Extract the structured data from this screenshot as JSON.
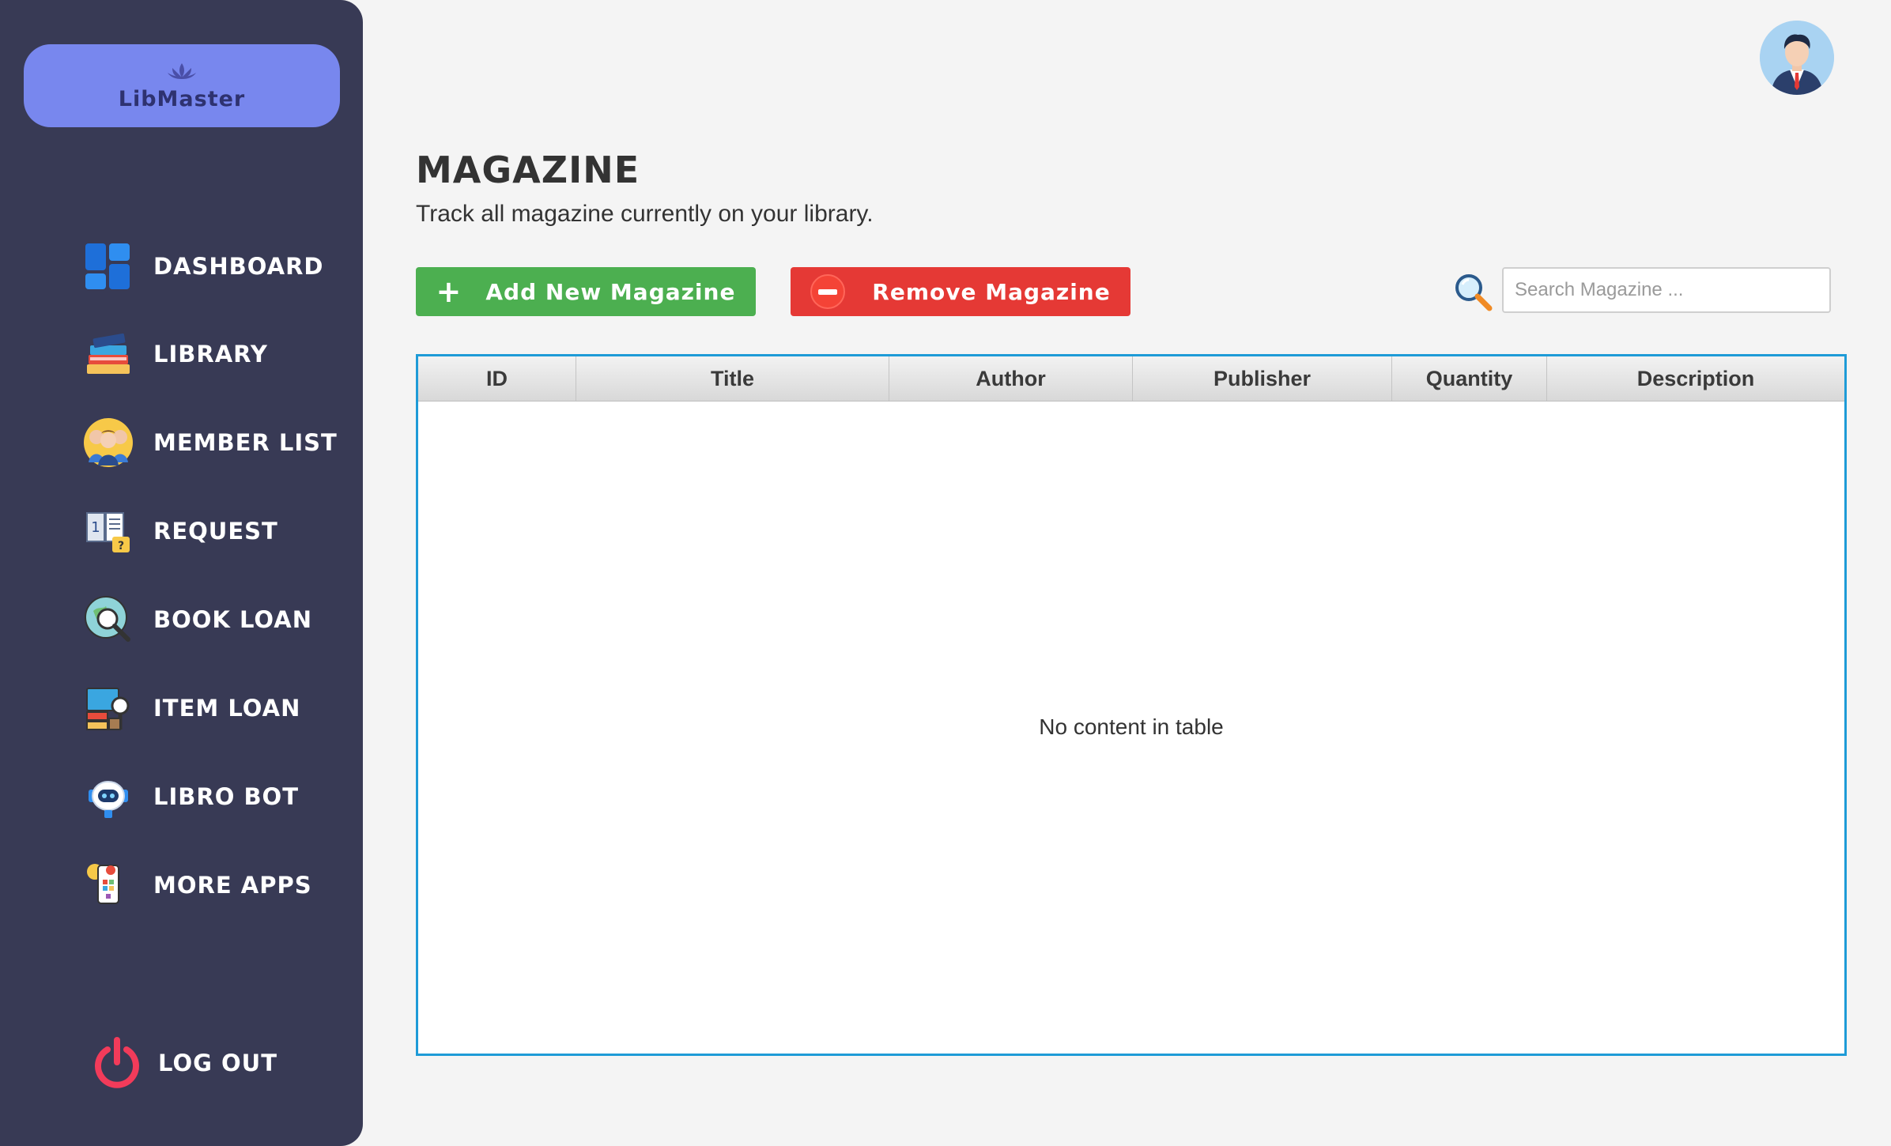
{
  "app": {
    "name": "LibMaster"
  },
  "sidebar": {
    "items": [
      {
        "label": "DASHBOARD",
        "icon": "dashboard-icon"
      },
      {
        "label": "LIBRARY",
        "icon": "books-icon"
      },
      {
        "label": "MEMBER LIST",
        "icon": "members-icon"
      },
      {
        "label": "REQUEST",
        "icon": "request-icon"
      },
      {
        "label": "BOOK LOAN",
        "icon": "book-loan-icon"
      },
      {
        "label": "ITEM LOAN",
        "icon": "item-loan-icon"
      },
      {
        "label": "LIBRO BOT",
        "icon": "robot-icon"
      },
      {
        "label": "MORE APPS",
        "icon": "apps-icon"
      }
    ],
    "logout_label": "LOG OUT"
  },
  "header": {
    "title": "MAGAZINE",
    "subtitle": "Track all magazine currently on your library."
  },
  "toolbar": {
    "add_label": "Add New Magazine",
    "remove_label": "Remove Magazine",
    "search_placeholder": "Search Magazine ..."
  },
  "table": {
    "columns": [
      "ID",
      "Title",
      "Author",
      "Publisher",
      "Quantity",
      "Description"
    ],
    "rows": [],
    "empty_message": "No content in table"
  },
  "colors": {
    "sidebar_bg": "#383a55",
    "logo_bg": "#7887ee",
    "add_button": "#4caf50",
    "remove_button": "#e53935",
    "table_border": "#1e9bd7"
  }
}
